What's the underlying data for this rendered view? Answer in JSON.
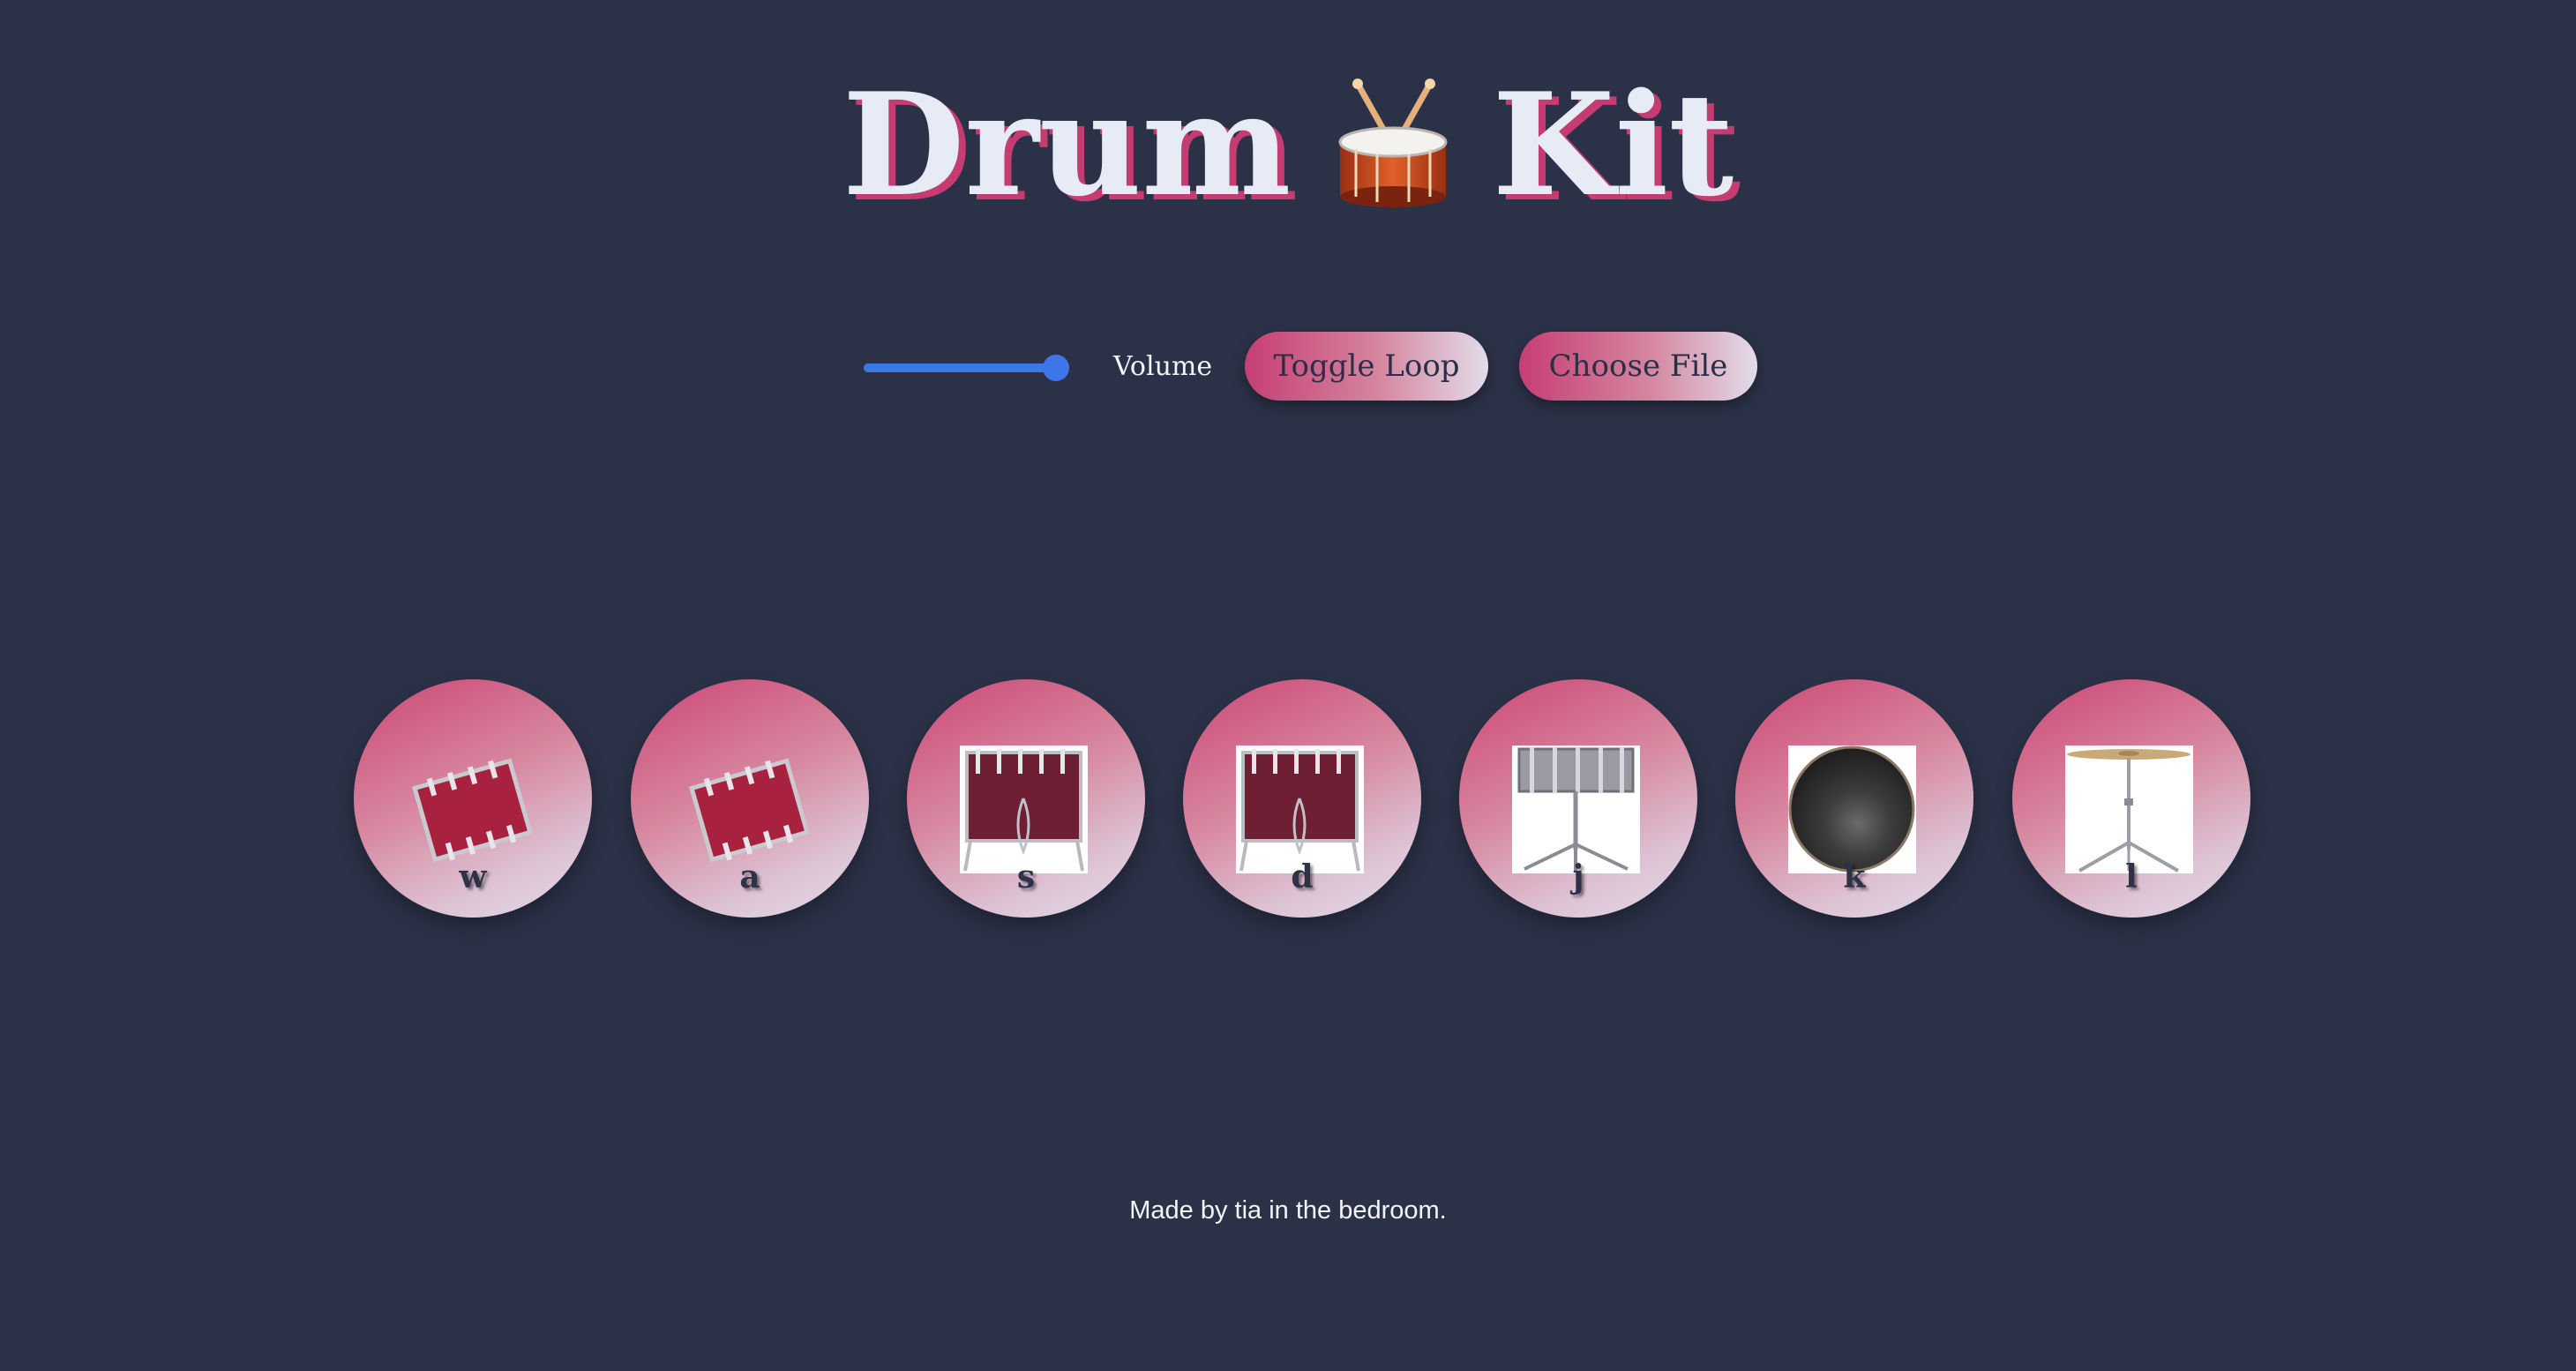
{
  "header": {
    "title_left": "Drum",
    "title_right": "Kit",
    "title_icon": "drum-with-sticks-icon"
  },
  "controls": {
    "volume_label": "Volume",
    "volume_level": 1.0,
    "loop_button": "Toggle Loop",
    "file_button": "Choose File",
    "accent_color": "#3e76e8"
  },
  "pads": [
    {
      "key": "w",
      "icon": "tom-drum-icon"
    },
    {
      "key": "a",
      "icon": "tom-drum-icon"
    },
    {
      "key": "s",
      "icon": "floor-tom-icon"
    },
    {
      "key": "d",
      "icon": "floor-tom-icon"
    },
    {
      "key": "j",
      "icon": "snare-drum-icon"
    },
    {
      "key": "k",
      "icon": "bass-drum-icon"
    },
    {
      "key": "l",
      "icon": "cymbal-icon"
    }
  ],
  "footer": {
    "text": "Made by tia in the bedroom."
  },
  "colors": {
    "background": "#2b3147",
    "pad_gradient_start": "#cc4676",
    "pad_gradient_end": "#e2dae8",
    "title_shadow": "#c43c72"
  }
}
